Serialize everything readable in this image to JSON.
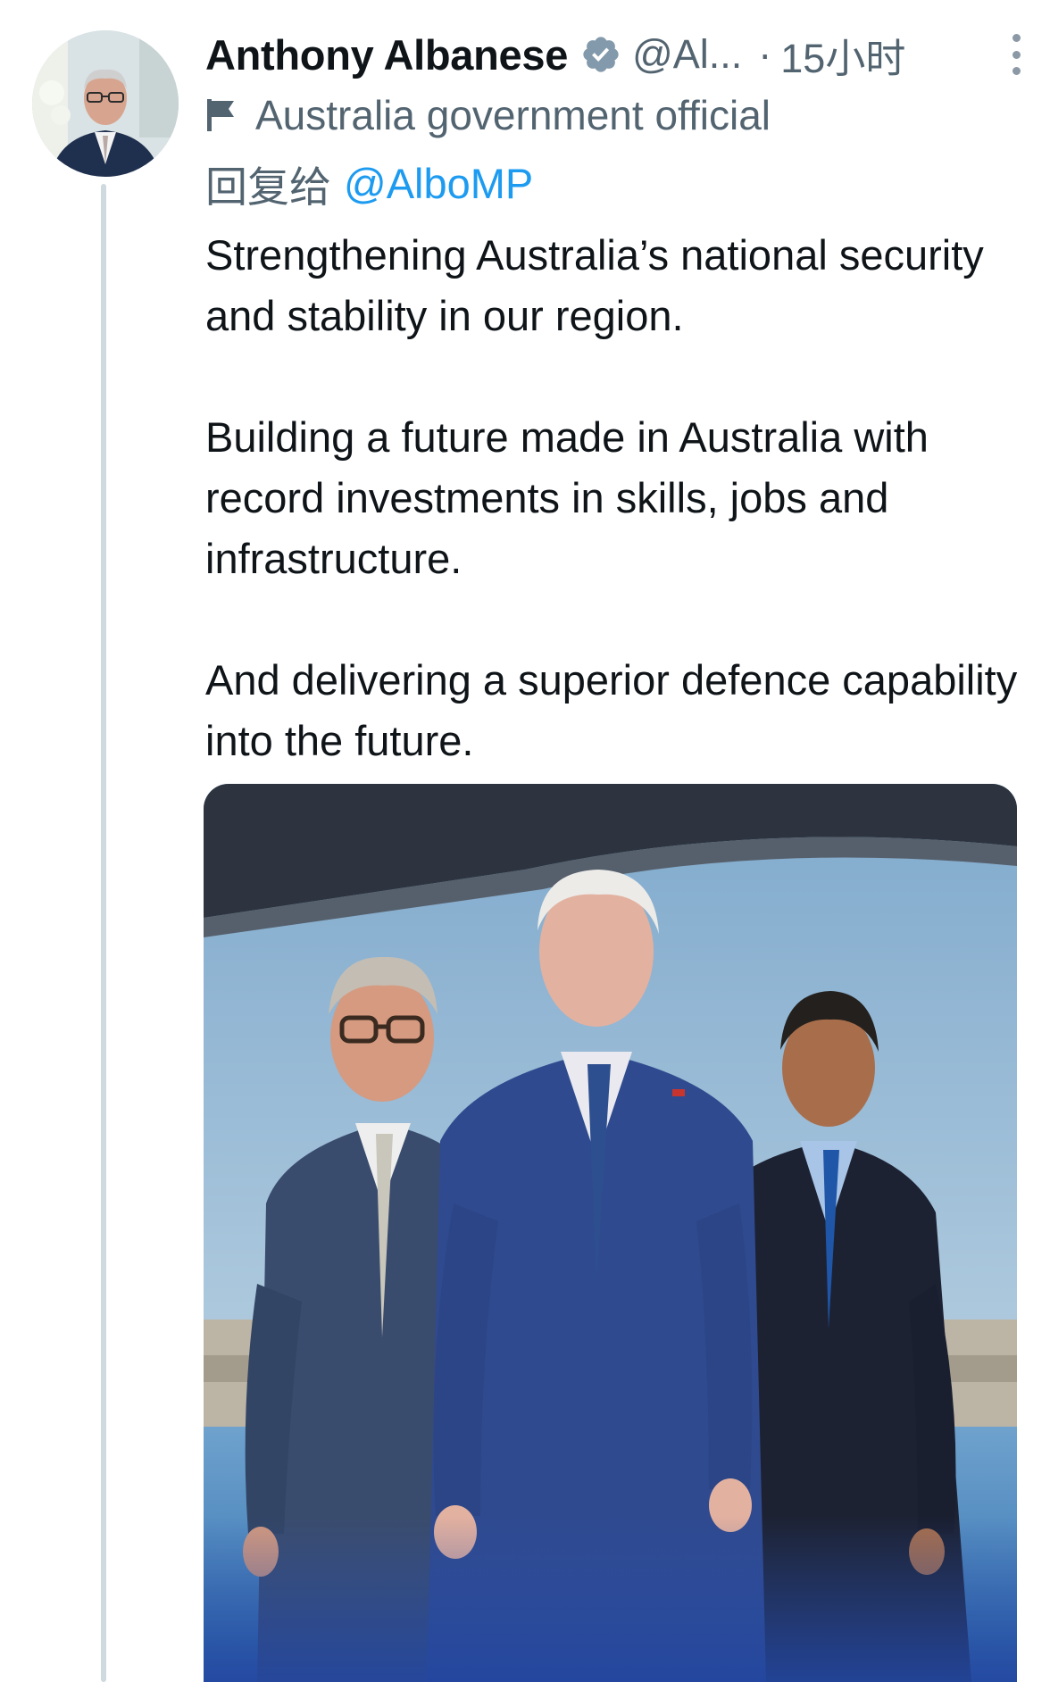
{
  "tweet": {
    "author": {
      "name": "Anthony Albanese",
      "handle_truncated": "@Al...",
      "verified_icon": "verified-badge-icon",
      "affiliation_icon": "flag-icon",
      "affiliation_label": "Australia government official"
    },
    "separator": "·",
    "timestamp": "15小时",
    "more_icon": "more-vertical-icon",
    "reply_prefix": "回复给",
    "reply_handle": "@AlboMP",
    "text": [
      "Strengthening Australia’s national security and stability in our region.",
      "Building a future made in Australia with record investments in skills, jobs and infrastructure.",
      "And delivering a superior defence capability into the future."
    ],
    "media": {
      "type": "photo"
    }
  },
  "colors": {
    "text_primary": "#0f1419",
    "text_secondary": "#536471",
    "link": "#1d9bf0",
    "thread_line": "#cfd9de",
    "badge": "#829aab"
  }
}
